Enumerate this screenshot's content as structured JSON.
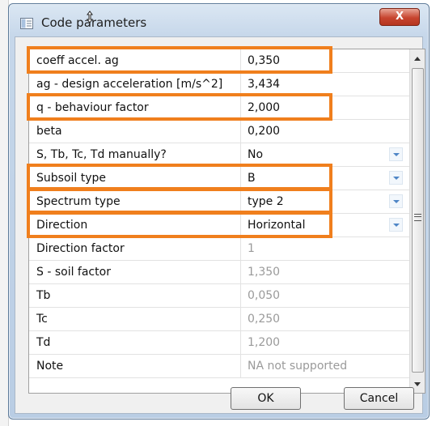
{
  "window": {
    "title": "Code parameters",
    "close_label": "X"
  },
  "grid": {
    "rows": [
      {
        "label": "coeff accel. ag",
        "value": "0,350",
        "dropdown": false,
        "readonly": false,
        "highlighted": true
      },
      {
        "label": "ag - design acceleration [m/s^2]",
        "value": "3,434",
        "dropdown": false,
        "readonly": false,
        "highlighted": false
      },
      {
        "label": "q - behaviour factor",
        "value": "2,000",
        "dropdown": false,
        "readonly": false,
        "highlighted": true
      },
      {
        "label": "beta",
        "value": "0,200",
        "dropdown": false,
        "readonly": false,
        "highlighted": false
      },
      {
        "label": "S, Tb, Tc, Td manually?",
        "value": "No",
        "dropdown": true,
        "readonly": false,
        "highlighted": false
      },
      {
        "label": "Subsoil type",
        "value": "B",
        "dropdown": true,
        "readonly": false,
        "highlighted": true
      },
      {
        "label": "Spectrum type",
        "value": "type 2",
        "dropdown": true,
        "readonly": false,
        "highlighted": true
      },
      {
        "label": "Direction",
        "value": "Horizontal",
        "dropdown": true,
        "readonly": false,
        "highlighted": true
      },
      {
        "label": "Direction factor",
        "value": "1",
        "dropdown": false,
        "readonly": true,
        "highlighted": false
      },
      {
        "label": "S - soil factor",
        "value": "1,350",
        "dropdown": false,
        "readonly": true,
        "highlighted": false
      },
      {
        "label": "Tb",
        "value": "0,050",
        "dropdown": false,
        "readonly": true,
        "highlighted": false
      },
      {
        "label": "Tc",
        "value": "0,250",
        "dropdown": false,
        "readonly": true,
        "highlighted": false
      },
      {
        "label": "Td",
        "value": "1,200",
        "dropdown": false,
        "readonly": true,
        "highlighted": false
      },
      {
        "label": "Note",
        "value": "NA not supported",
        "dropdown": false,
        "readonly": true,
        "highlighted": false
      }
    ]
  },
  "buttons": {
    "ok_label": "OK",
    "cancel_label": "Cancel"
  },
  "colors": {
    "highlight": "#f07f1d",
    "readonly_text": "#9a9a9a",
    "dropdown_arrow": "#4f86c6"
  }
}
